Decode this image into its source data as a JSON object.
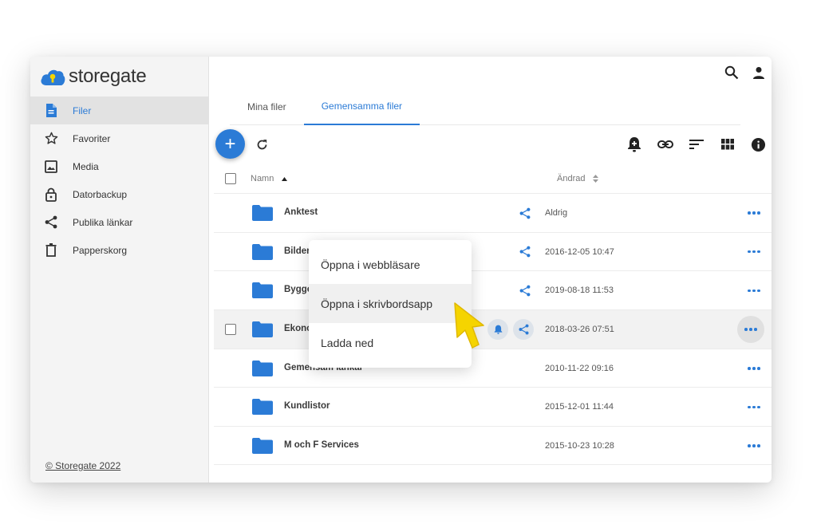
{
  "app": {
    "logo_text": "storegate"
  },
  "sidebar": {
    "items": [
      {
        "label": "Filer",
        "icon": "file-icon",
        "active": true
      },
      {
        "label": "Favoriter",
        "icon": "star-icon"
      },
      {
        "label": "Media",
        "icon": "image-icon"
      },
      {
        "label": "Datorbackup",
        "icon": "lock-icon"
      },
      {
        "label": "Publika länkar",
        "icon": "share-icon"
      },
      {
        "label": "Papperskorg",
        "icon": "trash-icon"
      }
    ],
    "copyright": "© Storegate 2022"
  },
  "tabs": [
    {
      "label": "Mina filer",
      "active": false
    },
    {
      "label": "Gemensamma filer",
      "active": true
    }
  ],
  "toolbar": {
    "add_label": "+",
    "icons": [
      "add-notification-icon",
      "link-icon",
      "sort-icon",
      "grid-view-icon",
      "info-icon"
    ]
  },
  "list": {
    "header": {
      "name": "Namn",
      "date": "Ändrad"
    },
    "rows": [
      {
        "name": "Anktest",
        "date": "Aldrig",
        "shared": true
      },
      {
        "name": "Bilder",
        "date": "2016-12-05 10:47",
        "shared": true
      },
      {
        "name": "Bygge",
        "date": "2019-08-18 11:53",
        "shared": true
      },
      {
        "name": "Ekonomi",
        "date": "2018-03-26 07:51",
        "shared": true,
        "hover": true
      },
      {
        "name": "Gemensam länkar",
        "date": "2010-11-22 09:16",
        "shared": false
      },
      {
        "name": "Kundlistor",
        "date": "2015-12-01 11:44",
        "shared": false
      },
      {
        "name": "M och F Services",
        "date": "2015-10-23 10:28",
        "shared": false
      }
    ]
  },
  "context_menu": {
    "items": [
      {
        "label": "Öppna i webbläsare"
      },
      {
        "label": "Öppna i skrivbordsapp",
        "highlighted": true
      },
      {
        "label": "Ladda ned"
      }
    ]
  },
  "colors": {
    "accent": "#2b7bd6",
    "folder": "#2b7bd6",
    "cursor": "#f5d400"
  }
}
